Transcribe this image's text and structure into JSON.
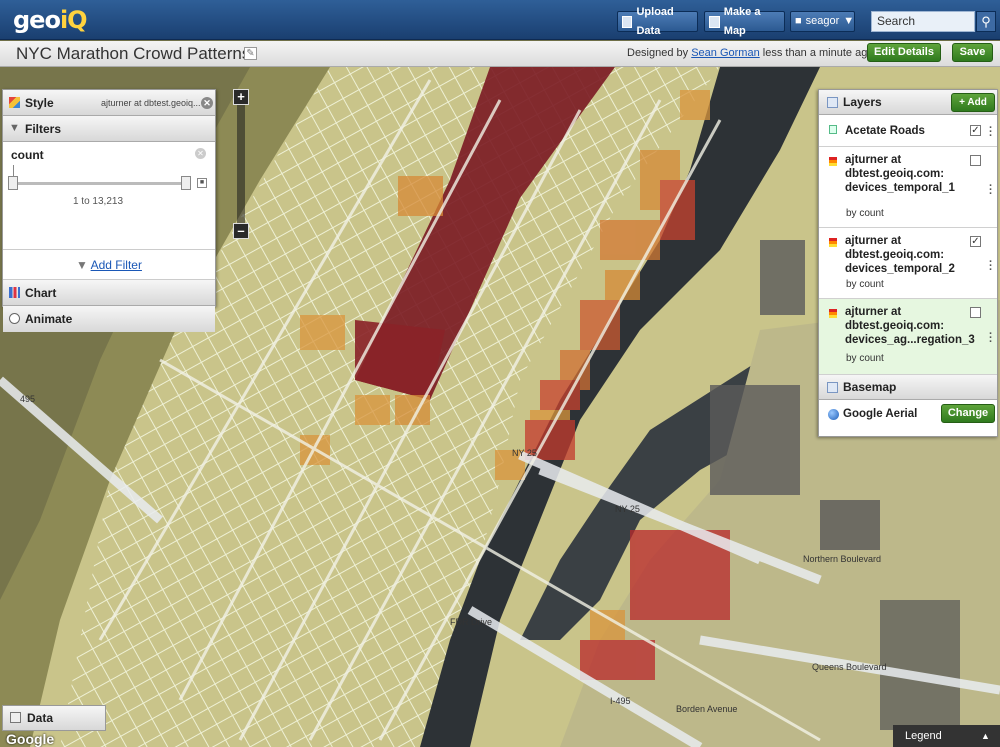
{
  "app": {
    "logo_geo": "geo",
    "logo_iq": "iQ"
  },
  "topbar": {
    "upload_label": "Upload Data",
    "make_map_label": "Make a Map",
    "user_label": "seagor",
    "search_placeholder": "Search"
  },
  "titlebar": {
    "title": "NYC Marathon Crowd Patterns",
    "designed_by_prefix": "Designed by",
    "author": "Sean Gorman",
    "time_ago": "less than a minute ago",
    "edit_details_label": "Edit Details",
    "save_label": "Save"
  },
  "left_panel": {
    "style_label": "Style",
    "style_sub": "ajturner at dbtest.geoiq...",
    "filters_label": "Filters",
    "filter": {
      "name": "count",
      "range_text": "1 to 13,213"
    },
    "add_filter_label": "Add Filter",
    "chart_label": "Chart",
    "animate_label": "Animate"
  },
  "data_panel": {
    "label": "Data"
  },
  "zoom": {
    "in_label": "+",
    "out_label": "–"
  },
  "right_panel": {
    "layers_label": "Layers",
    "add_label": "+ Add",
    "layers": [
      {
        "name": "Acetate Roads",
        "sub": "",
        "checked": true
      },
      {
        "name": "ajturner at dbtest.geoiq.com: devices_temporal_1",
        "sub": "by count",
        "checked": false
      },
      {
        "name": "ajturner at dbtest.geoiq.com: devices_temporal_2",
        "sub": "by count",
        "checked": true
      },
      {
        "name": "ajturner at dbtest.geoiq.com: devices_ag...regation_3",
        "sub": "by count",
        "checked": false
      }
    ],
    "basemap_label": "Basemap",
    "basemap_name": "Google Aerial",
    "change_label": "Change"
  },
  "map_labels": {
    "ny25_a": "NY 25",
    "ny25_b": "NY 25",
    "i495": "495",
    "i495_b": "I-495",
    "northern_blvd": "Northern Boulevard",
    "queens_blvd": "Queens Boulevard",
    "borden_ave": "Borden Avenue",
    "fdr": "FDR Drive"
  },
  "footer": {
    "legend_label": "Legend",
    "google_label": "Google"
  },
  "colors": {
    "accent_blue": "#1a3f70",
    "save_green": "#2f7a1e",
    "heat_dark": "#7a1a22",
    "heat_mid": "#c8432f",
    "heat_low": "#d9953c"
  }
}
